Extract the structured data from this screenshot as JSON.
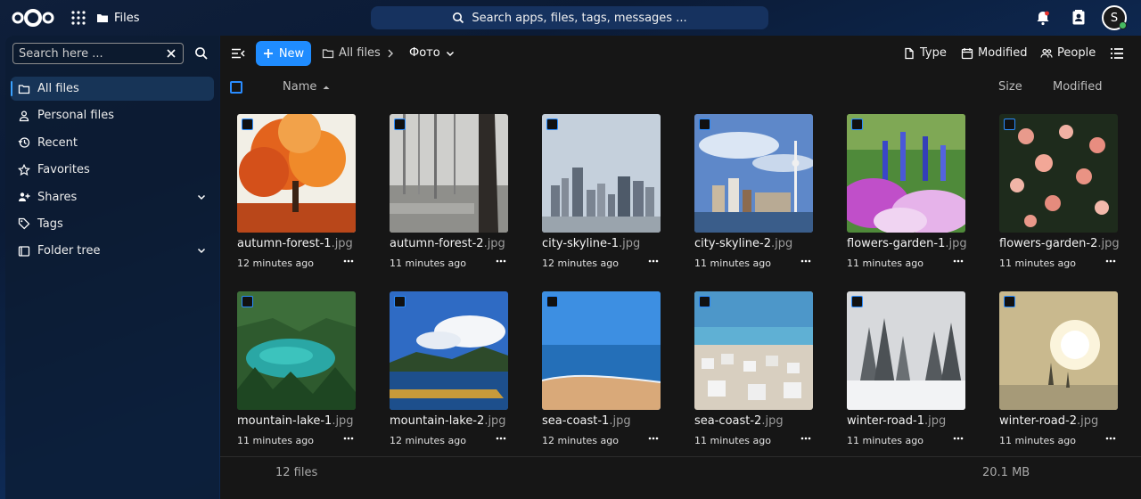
{
  "header": {
    "app_name": "Files",
    "search_placeholder": "Search apps, files, tags, messages ...",
    "avatar_initial": "S"
  },
  "sidebar": {
    "filter_placeholder": "Search here ...",
    "items": [
      {
        "label": "All files",
        "icon": "folder-icon",
        "active": true
      },
      {
        "label": "Personal files",
        "icon": "person-icon"
      },
      {
        "label": "Recent",
        "icon": "history-icon"
      },
      {
        "label": "Favorites",
        "icon": "star-icon"
      },
      {
        "label": "Shares",
        "icon": "share-icon",
        "expandable": true
      },
      {
        "label": "Tags",
        "icon": "tag-icon"
      },
      {
        "label": "Folder tree",
        "icon": "folder-tree-icon",
        "expandable": true
      }
    ]
  },
  "toolbar": {
    "new_label": "New",
    "breadcrumb_root": "All files",
    "breadcrumb_current": "Фото",
    "filter_type": "Type",
    "filter_modified": "Modified",
    "filter_people": "People"
  },
  "list_header": {
    "name": "Name",
    "size": "Size",
    "modified": "Modified"
  },
  "files": [
    {
      "name": "autumn-forest-1",
      "ext": ".jpg",
      "modified": "12 minutes ago"
    },
    {
      "name": "autumn-forest-2",
      "ext": ".jpg",
      "modified": "11 minutes ago"
    },
    {
      "name": "city-skyline-1",
      "ext": ".jpg",
      "modified": "12 minutes ago"
    },
    {
      "name": "city-skyline-2",
      "ext": ".jpg",
      "modified": "11 minutes ago"
    },
    {
      "name": "flowers-garden-1",
      "ext": ".jpg",
      "modified": "11 minutes ago"
    },
    {
      "name": "flowers-garden-2",
      "ext": ".jpg",
      "modified": "11 minutes ago"
    },
    {
      "name": "mountain-lake-1",
      "ext": ".jpg",
      "modified": "11 minutes ago"
    },
    {
      "name": "mountain-lake-2",
      "ext": ".jpg",
      "modified": "12 minutes ago"
    },
    {
      "name": "sea-coast-1",
      "ext": ".jpg",
      "modified": "12 minutes ago"
    },
    {
      "name": "sea-coast-2",
      "ext": ".jpg",
      "modified": "11 minutes ago"
    },
    {
      "name": "winter-road-1",
      "ext": ".jpg",
      "modified": "11 minutes ago"
    },
    {
      "name": "winter-road-2",
      "ext": ".jpg",
      "modified": "11 minutes ago"
    }
  ],
  "summary": {
    "count": "12 files",
    "total_size": "20.1 MB"
  },
  "colors": {
    "accent": "#1f8cff",
    "main_bg": "#161616",
    "sidebar_active": "#173457",
    "status_online": "#46ba61"
  }
}
